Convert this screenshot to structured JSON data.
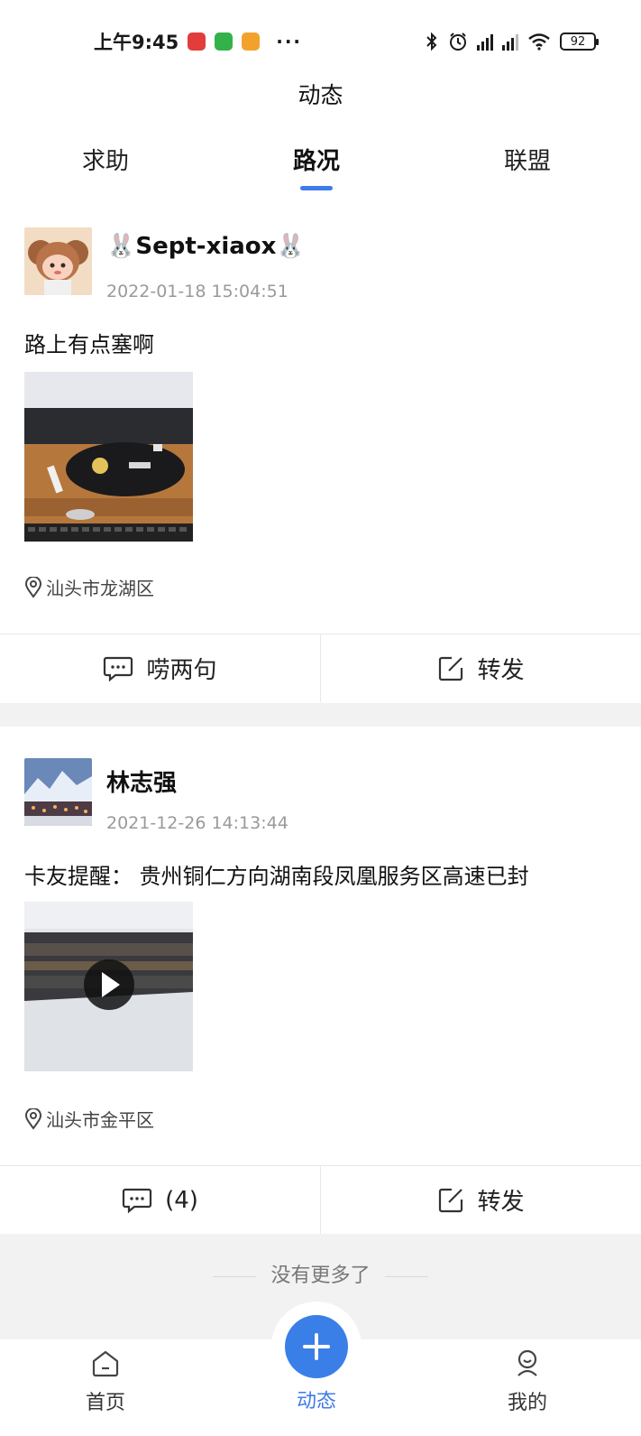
{
  "status_bar": {
    "time": "上午9:45",
    "more": "···",
    "battery": "92"
  },
  "header": {
    "title": "动态"
  },
  "tabs": [
    {
      "label": "求助",
      "active": false
    },
    {
      "label": "路况",
      "active": true
    },
    {
      "label": "联盟",
      "active": false
    }
  ],
  "posts": [
    {
      "username": "🐰Sept-xiaox🐰",
      "time": "2022-01-18 15:04:51",
      "text": "路上有点塞啊",
      "media_type": "image",
      "location": "汕头市龙湖区",
      "comment_label": "唠两句",
      "forward_label": "转发"
    },
    {
      "username": "林志强",
      "time": "2021-12-26 14:13:44",
      "text": "卡友提醒： 贵州铜仁方向湖南段凤凰服务区高速已封",
      "media_type": "video",
      "location": "汕头市金平区",
      "comment_label": "(4)",
      "forward_label": "转发"
    }
  ],
  "footer": {
    "no_more": "没有更多了"
  },
  "bottom_nav": [
    {
      "label": "首页",
      "icon": "home-icon",
      "active": false
    },
    {
      "label": "动态",
      "icon": "plus-icon",
      "active": true
    },
    {
      "label": "我的",
      "icon": "profile-icon",
      "active": false
    }
  ],
  "colors": {
    "accent": "#3f7ce8",
    "fab": "#3a7ee8",
    "band": "#f2f2f2"
  }
}
